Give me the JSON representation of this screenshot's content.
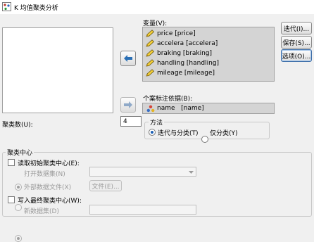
{
  "window": {
    "title": "K 均值聚类分析"
  },
  "variables": {
    "label": "变量(V):",
    "items": [
      {
        "label": "price [price]",
        "icon": "scale-pencil-icon"
      },
      {
        "label": "accelera [accelera]",
        "icon": "scale-pencil-icon"
      },
      {
        "label": "braking [braking]",
        "icon": "scale-pencil-icon"
      },
      {
        "label": "handling [handling]",
        "icon": "scale-pencil-icon"
      },
      {
        "label": "mileage [mileage]",
        "icon": "scale-pencil-icon"
      }
    ]
  },
  "case_label": {
    "label": "个案标注依据(B):",
    "value": "name   [name]",
    "icon": "nominal-variable-icon"
  },
  "buttons": {
    "iterate": "迭代(I)...",
    "save": "保存(S)...",
    "options": "选项(O)..."
  },
  "clusters": {
    "label": "聚类数(U):",
    "value": "4"
  },
  "method": {
    "title": "方法",
    "options": [
      {
        "label": "迭代与分类(T)",
        "selected": true
      },
      {
        "label": "仅分类(Y)",
        "selected": false
      }
    ]
  },
  "centers": {
    "title": "聚类中心",
    "read_initial": {
      "label": "读取初始聚类中心(E):",
      "checked": false
    },
    "open_dataset": {
      "label": "打开数据集(N)"
    },
    "external_file": {
      "label": "外部数据文件(X)",
      "button": "文件(E)..."
    },
    "write_final": {
      "label": "写入最终聚类中心(W):",
      "checked": false
    },
    "new_dataset": {
      "label": "新数据集(D)"
    }
  }
}
